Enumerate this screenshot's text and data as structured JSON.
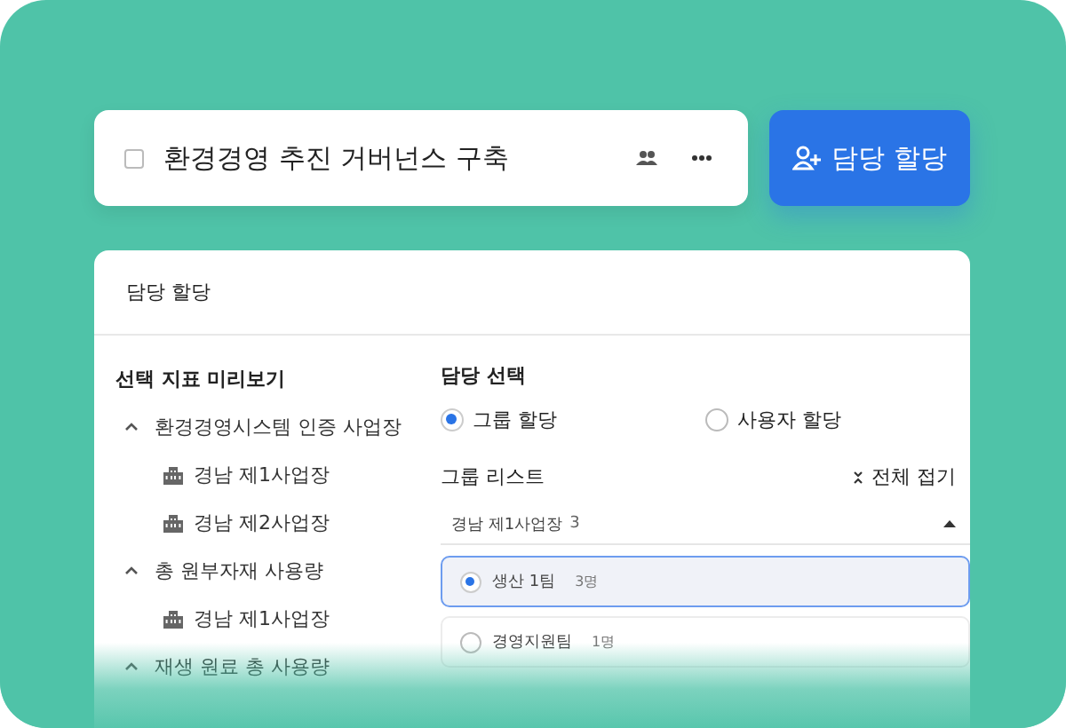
{
  "task": {
    "checked": false,
    "title": "환경경영 추진 거버넌스 구축"
  },
  "assign_button": {
    "label": "담당 할당"
  },
  "panel": {
    "title": "담당 할당",
    "preview": {
      "heading": "선택 지표 미리보기",
      "tree": [
        {
          "label": "환경경영시스템 인증 사업장",
          "expanded": true,
          "children": [
            {
              "label": "경남 제1사업장"
            },
            {
              "label": "경남 제2사업장"
            }
          ]
        },
        {
          "label": "총 원부자재 사용량",
          "expanded": true,
          "children": [
            {
              "label": "경남 제1사업장"
            }
          ]
        },
        {
          "label": "재생 원료 총 사용량",
          "expanded": true
        }
      ]
    },
    "assignee": {
      "heading": "담당 선택",
      "modes": [
        {
          "label": "그룹 할당",
          "selected": true
        },
        {
          "label": "사용자 할당",
          "selected": false
        }
      ],
      "group_list": {
        "heading": "그룹 리스트",
        "collapse_all": "전체 접기",
        "site": {
          "label": "경남 제1사업장",
          "count": "3",
          "expanded": true
        },
        "groups": [
          {
            "name": "생산 1팀",
            "count": "3명",
            "selected": true
          },
          {
            "name": "경영지원팀",
            "count": "1명",
            "selected": false
          }
        ]
      }
    }
  }
}
